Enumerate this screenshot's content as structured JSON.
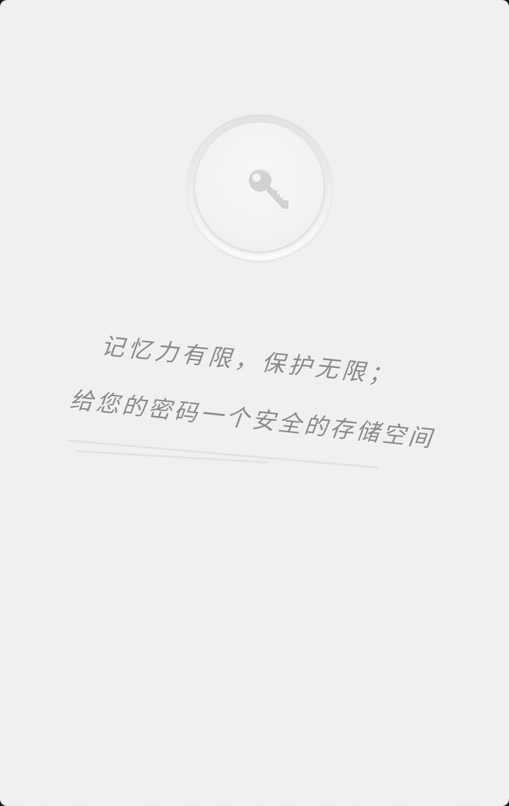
{
  "lock_screen": {
    "key_button_icon": "key-icon",
    "slogan": {
      "line1": "记忆力有限，保护无限；",
      "line2": "给您的密码一个安全的存储空间"
    }
  },
  "colors": {
    "background": "#f3f3f2",
    "text": "#8a8a8a",
    "icon": "#d3d3d3"
  }
}
